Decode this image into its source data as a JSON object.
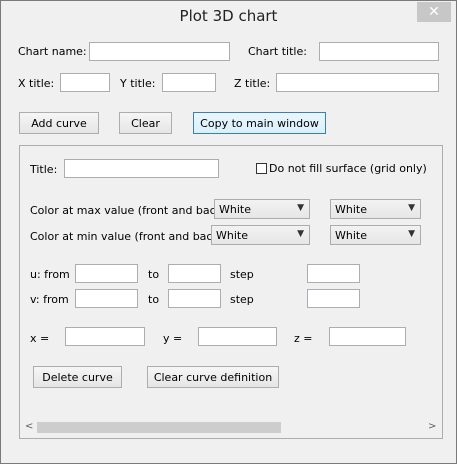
{
  "window": {
    "title": "Plot 3D chart",
    "close_symbol": "✕"
  },
  "form": {
    "chart_name_label": "Chart name:",
    "chart_name_value": "",
    "chart_title_label": "Chart title:",
    "chart_title_value": "",
    "x_title_label": "X title:",
    "x_title_value": "",
    "y_title_label": "Y title:",
    "y_title_value": "",
    "z_title_label": "Z title:",
    "z_title_value": ""
  },
  "buttons": {
    "add_curve": "Add curve",
    "clear": "Clear",
    "copy_to_main": "Copy to main window"
  },
  "curve": {
    "title_label": "Title:",
    "title_value": "",
    "no_fill_label": "Do not fill surface (grid only)",
    "no_fill_checked": false,
    "color_max_label": "Color at max value (front and back):",
    "color_max_front": "White",
    "color_max_back": "White",
    "color_min_label": "Color at min value (front and back):",
    "color_min_front": "White",
    "color_min_back": "White",
    "u_from_label": "u: from",
    "v_from_label": "v: from",
    "to_label": "to",
    "step_label": "step",
    "u_from": "",
    "u_to": "",
    "u_step": "",
    "v_from": "",
    "v_to": "",
    "v_step": "",
    "x_label": "x =",
    "y_label": "y =",
    "z_label": "z =",
    "x_expr": "",
    "y_expr": "",
    "z_expr": "",
    "delete_curve": "Delete curve",
    "clear_definition": "Clear curve definition"
  },
  "scrollbar": {
    "left_arrow": "<",
    "right_arrow": ">"
  }
}
